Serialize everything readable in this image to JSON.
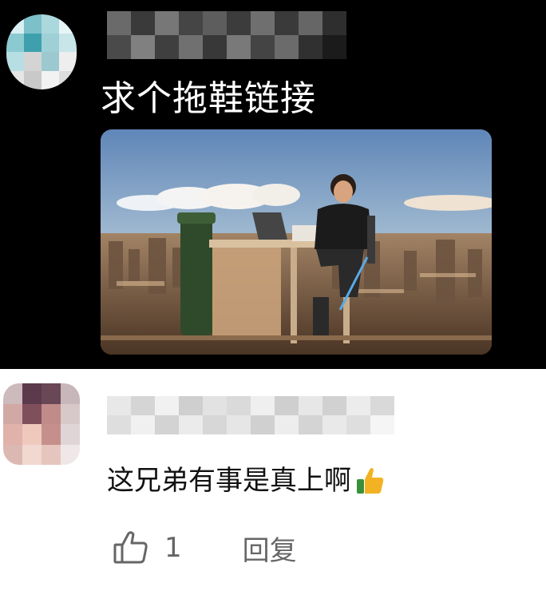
{
  "post": {
    "comment_text": "求个拖鞋链接",
    "avatar_icon": "blurred-avatar",
    "username_state": "blurred",
    "photo_icon": "man-at-desk-over-city-photo"
  },
  "reply_thread": {
    "comment_text": "这兄弟有事是真上啊",
    "emoji": "thumbs-up-emoji",
    "avatar_icon": "blurred-avatar",
    "username_state": "blurred",
    "like_count": "1",
    "reply_label": "回复"
  },
  "colors": {
    "top_bg": "#000000",
    "bottom_bg": "#ffffff",
    "muted": "#666666",
    "thumb": "#f3b224"
  }
}
